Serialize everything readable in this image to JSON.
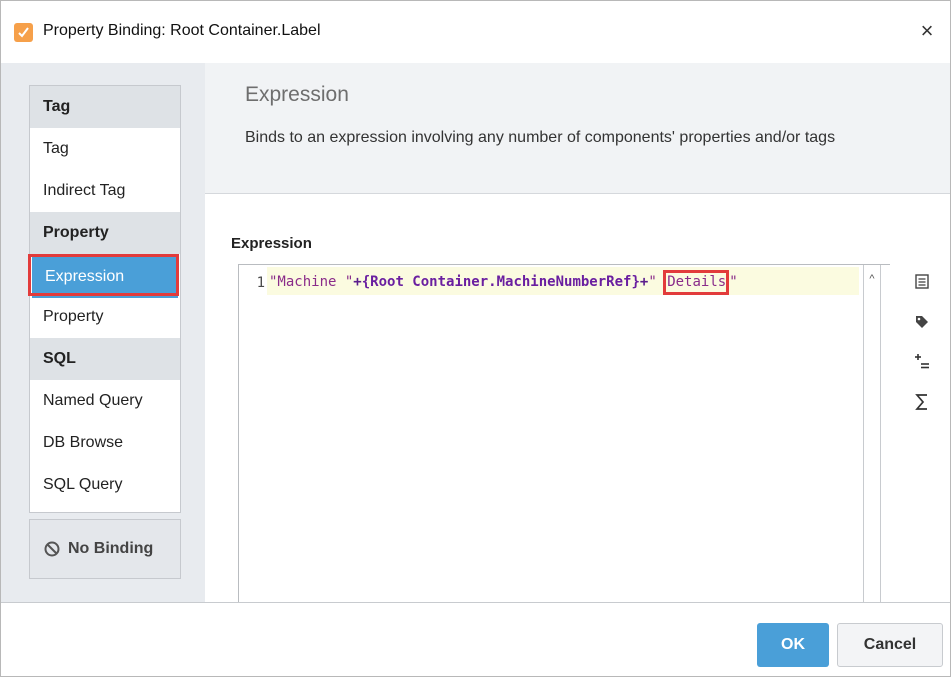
{
  "window": {
    "title": "Property Binding: Root Container.Label",
    "app_icon": "ignition-binding-icon",
    "close_glyph": "×"
  },
  "binding_types": {
    "categories": [
      {
        "label": "Tag",
        "items": [
          "Tag",
          "Indirect Tag"
        ]
      },
      {
        "label": "Property",
        "items": [
          "Expression",
          "Property"
        ]
      },
      {
        "label": "SQL",
        "items": [
          "Named Query",
          "DB Browse",
          "SQL Query"
        ]
      }
    ],
    "selected": "Expression",
    "no_binding_label": "No Binding"
  },
  "info": {
    "title": "Expression",
    "description": "Binds to an expression involving any number of components' properties and/or tags"
  },
  "expression": {
    "section_label": "Expression",
    "line_number": "1",
    "tokens": {
      "str_open": "\"Machine \"",
      "plus1": "+",
      "ref": "{Root Container.MachineNumberRef}",
      "plus2": "+",
      "str2_quote": "\" ",
      "str2_word": "Details",
      "str2_close": "\""
    },
    "highlighted_text": "Details"
  },
  "tools": [
    "document-icon",
    "tag-icon",
    "add-operator-icon",
    "sigma-function-icon"
  ],
  "buttons": {
    "ok": "OK",
    "cancel": "Cancel"
  },
  "colors": {
    "accent": "#4a9fd8",
    "highlight_box": "#e23b3b",
    "string_token": "#8a2c8a",
    "reference_token": "#6a1fa0"
  }
}
